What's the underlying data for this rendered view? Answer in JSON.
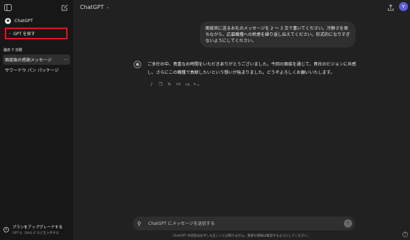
{
  "sidebar": {
    "toggle_icon": "sidebar-toggle-icon",
    "new_chat_icon": "edit-icon",
    "chatgpt_label": "ChatGPT",
    "explore_label": "GPT を探す",
    "section_title": "過去 7 日間",
    "history": [
      {
        "label": "面接後の感謝メッセージ",
        "active": true
      },
      {
        "label": "サワードウ パン パッケージ",
        "active": false
      }
    ],
    "more": "···",
    "upgrade_title": "プランをアップグレードする",
    "upgrade_sub": "GPT-4、DALL·E などを入手する"
  },
  "header": {
    "model_label": "ChatGPT",
    "avatar_letter": "Y"
  },
  "conversation": {
    "user_message": "面接官に送るお礼のメッセージを 2 ～ 3 文で書いてください。冷静さを保ちながら、応募職種への熱意を繰り返し伝えてください。形式的になりすぎないようにしてください。",
    "assistant_message": "ご多忙の中、貴重なお時間をいただきありがとうございました。今回の面接を通じて、貴社のビジョンに共感し、さらにこの職種で貢献したいという想いが強まりました。どうぞよろしくお願いいたします。"
  },
  "composer": {
    "placeholder": "ChatGPT にメッセージを送信する"
  },
  "footer": {
    "note": "ChatGPT の回答は必ずしも正しいとは限りません。重要な情報は確認するようにしてください。",
    "help": "?"
  },
  "colors": {
    "sidebar_bg": "#171717",
    "main_bg": "#212121",
    "bubble_bg": "#2f2f2f",
    "highlight_border": "#e0171f",
    "avatar_bg": "#5b5fd6"
  }
}
